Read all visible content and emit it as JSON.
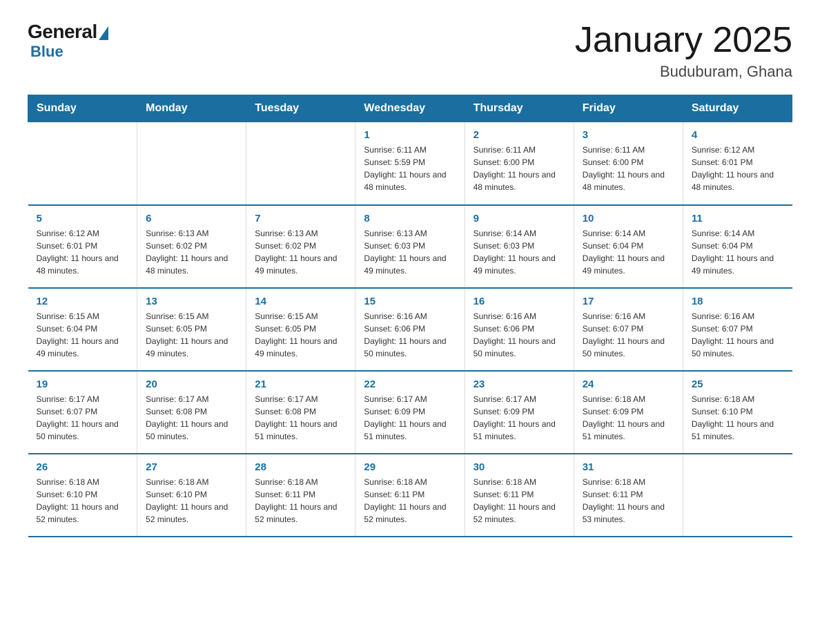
{
  "logo": {
    "general": "General",
    "blue": "Blue"
  },
  "title": "January 2025",
  "subtitle": "Buduburam, Ghana",
  "days_of_week": [
    "Sunday",
    "Monday",
    "Tuesday",
    "Wednesday",
    "Thursday",
    "Friday",
    "Saturday"
  ],
  "weeks": [
    [
      {
        "day": "",
        "info": ""
      },
      {
        "day": "",
        "info": ""
      },
      {
        "day": "",
        "info": ""
      },
      {
        "day": "1",
        "info": "Sunrise: 6:11 AM\nSunset: 5:59 PM\nDaylight: 11 hours and 48 minutes."
      },
      {
        "day": "2",
        "info": "Sunrise: 6:11 AM\nSunset: 6:00 PM\nDaylight: 11 hours and 48 minutes."
      },
      {
        "day": "3",
        "info": "Sunrise: 6:11 AM\nSunset: 6:00 PM\nDaylight: 11 hours and 48 minutes."
      },
      {
        "day": "4",
        "info": "Sunrise: 6:12 AM\nSunset: 6:01 PM\nDaylight: 11 hours and 48 minutes."
      }
    ],
    [
      {
        "day": "5",
        "info": "Sunrise: 6:12 AM\nSunset: 6:01 PM\nDaylight: 11 hours and 48 minutes."
      },
      {
        "day": "6",
        "info": "Sunrise: 6:13 AM\nSunset: 6:02 PM\nDaylight: 11 hours and 48 minutes."
      },
      {
        "day": "7",
        "info": "Sunrise: 6:13 AM\nSunset: 6:02 PM\nDaylight: 11 hours and 49 minutes."
      },
      {
        "day": "8",
        "info": "Sunrise: 6:13 AM\nSunset: 6:03 PM\nDaylight: 11 hours and 49 minutes."
      },
      {
        "day": "9",
        "info": "Sunrise: 6:14 AM\nSunset: 6:03 PM\nDaylight: 11 hours and 49 minutes."
      },
      {
        "day": "10",
        "info": "Sunrise: 6:14 AM\nSunset: 6:04 PM\nDaylight: 11 hours and 49 minutes."
      },
      {
        "day": "11",
        "info": "Sunrise: 6:14 AM\nSunset: 6:04 PM\nDaylight: 11 hours and 49 minutes."
      }
    ],
    [
      {
        "day": "12",
        "info": "Sunrise: 6:15 AM\nSunset: 6:04 PM\nDaylight: 11 hours and 49 minutes."
      },
      {
        "day": "13",
        "info": "Sunrise: 6:15 AM\nSunset: 6:05 PM\nDaylight: 11 hours and 49 minutes."
      },
      {
        "day": "14",
        "info": "Sunrise: 6:15 AM\nSunset: 6:05 PM\nDaylight: 11 hours and 49 minutes."
      },
      {
        "day": "15",
        "info": "Sunrise: 6:16 AM\nSunset: 6:06 PM\nDaylight: 11 hours and 50 minutes."
      },
      {
        "day": "16",
        "info": "Sunrise: 6:16 AM\nSunset: 6:06 PM\nDaylight: 11 hours and 50 minutes."
      },
      {
        "day": "17",
        "info": "Sunrise: 6:16 AM\nSunset: 6:07 PM\nDaylight: 11 hours and 50 minutes."
      },
      {
        "day": "18",
        "info": "Sunrise: 6:16 AM\nSunset: 6:07 PM\nDaylight: 11 hours and 50 minutes."
      }
    ],
    [
      {
        "day": "19",
        "info": "Sunrise: 6:17 AM\nSunset: 6:07 PM\nDaylight: 11 hours and 50 minutes."
      },
      {
        "day": "20",
        "info": "Sunrise: 6:17 AM\nSunset: 6:08 PM\nDaylight: 11 hours and 50 minutes."
      },
      {
        "day": "21",
        "info": "Sunrise: 6:17 AM\nSunset: 6:08 PM\nDaylight: 11 hours and 51 minutes."
      },
      {
        "day": "22",
        "info": "Sunrise: 6:17 AM\nSunset: 6:09 PM\nDaylight: 11 hours and 51 minutes."
      },
      {
        "day": "23",
        "info": "Sunrise: 6:17 AM\nSunset: 6:09 PM\nDaylight: 11 hours and 51 minutes."
      },
      {
        "day": "24",
        "info": "Sunrise: 6:18 AM\nSunset: 6:09 PM\nDaylight: 11 hours and 51 minutes."
      },
      {
        "day": "25",
        "info": "Sunrise: 6:18 AM\nSunset: 6:10 PM\nDaylight: 11 hours and 51 minutes."
      }
    ],
    [
      {
        "day": "26",
        "info": "Sunrise: 6:18 AM\nSunset: 6:10 PM\nDaylight: 11 hours and 52 minutes."
      },
      {
        "day": "27",
        "info": "Sunrise: 6:18 AM\nSunset: 6:10 PM\nDaylight: 11 hours and 52 minutes."
      },
      {
        "day": "28",
        "info": "Sunrise: 6:18 AM\nSunset: 6:11 PM\nDaylight: 11 hours and 52 minutes."
      },
      {
        "day": "29",
        "info": "Sunrise: 6:18 AM\nSunset: 6:11 PM\nDaylight: 11 hours and 52 minutes."
      },
      {
        "day": "30",
        "info": "Sunrise: 6:18 AM\nSunset: 6:11 PM\nDaylight: 11 hours and 52 minutes."
      },
      {
        "day": "31",
        "info": "Sunrise: 6:18 AM\nSunset: 6:11 PM\nDaylight: 11 hours and 53 minutes."
      },
      {
        "day": "",
        "info": ""
      }
    ]
  ]
}
